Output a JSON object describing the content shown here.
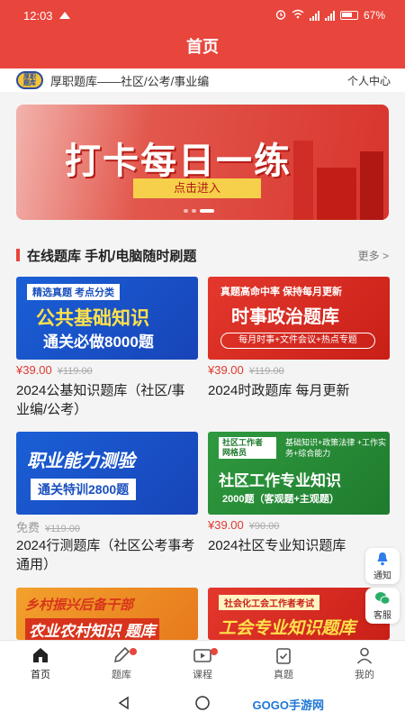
{
  "status": {
    "time": "12:03",
    "battery": "67%"
  },
  "header": {
    "title": "首页"
  },
  "brand": {
    "logo_top": "厚职",
    "logo_bottom": "题库",
    "name": "厚职题库——社区/公考/事业编",
    "user_center": "个人中心"
  },
  "banner": {
    "headline": "打卡每日一练",
    "button": "点击进入",
    "slides": 3,
    "active_slide": 2
  },
  "section": {
    "title": "在线题库 手机/电脑随时刷题",
    "more": "更多 >"
  },
  "products": [
    {
      "thumb_tag": "精选真题 考点分类",
      "thumb_line1": "公共基础知识",
      "thumb_line2": "通关必做8000题",
      "price": "¥39.00",
      "old_price": "¥119.00",
      "title": "2024公基知识题库（社区/事业编/公考）"
    },
    {
      "thumb_tag": "真题高命中率 保持每月更新",
      "thumb_line1": "时事政治题库",
      "thumb_line2": "每月时事+文件会议+热点专题",
      "price": "¥39.00",
      "old_price": "¥119.00",
      "title": "2024时政题库 每月更新"
    },
    {
      "thumb_line1": "职业能力测验",
      "thumb_line2": "通关特训2800题",
      "price": "免费",
      "old_price": "¥119.00",
      "title": "2024行测题库（社区公考事考通用）"
    },
    {
      "thumb_tag": "社区工作者 网格员",
      "thumb_tag2": "基础知识+政策法律 +工作实务+综合能力",
      "thumb_line1": "社区工作专业知识",
      "thumb_line2": "2000题（客观题+主观题）",
      "price": "¥39.00",
      "old_price": "¥90.00",
      "title": "2024社区专业知识题库"
    },
    {
      "thumb_line1": "乡村振兴后备干部",
      "thumb_line2": "农业农村知识 题库"
    },
    {
      "thumb_tag": "社会化工会工作者考试",
      "thumb_line1": "工会专业知识题库"
    }
  ],
  "float_buttons": {
    "notice": "通知",
    "service": "客服"
  },
  "bottom_nav": [
    "首页",
    "题库",
    "课程",
    "真题",
    "我的"
  ],
  "watermark": "GOGO手游网",
  "colors": {
    "accent": "#e8453c",
    "price": "#e0392f"
  }
}
